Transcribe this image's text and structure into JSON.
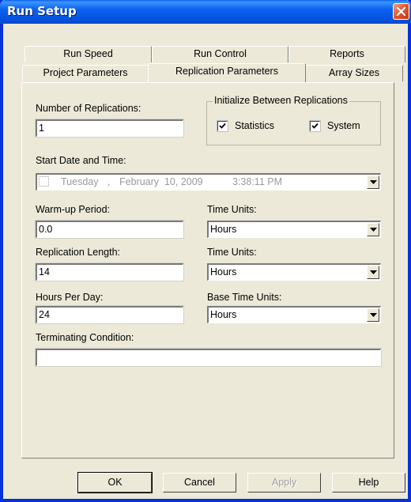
{
  "window": {
    "title": "Run Setup",
    "title_bar_color": "#0b61ee",
    "face_color": "#ece9d8"
  },
  "tabs": {
    "back_row": [
      "Run Speed",
      "Run Control",
      "Reports"
    ],
    "front_row": [
      "Project Parameters",
      "Replication Parameters",
      "Array Sizes"
    ],
    "active": "Replication Parameters"
  },
  "form": {
    "num_replications_label": "Number of Replications:",
    "num_replications_value": "1",
    "init_group_title": "Initialize Between Replications",
    "statistics_label": "Statistics",
    "statistics_checked": true,
    "system_label": "System",
    "system_checked": true,
    "start_date_label": "Start Date and Time:",
    "start_date_day": "Tuesday",
    "start_date_sep": ",",
    "start_date_date": "February  10, 2009",
    "start_date_time": "3:38:11 PM",
    "warmup_label": "Warm-up Period:",
    "warmup_value": "0.0",
    "warmup_units_label": "Time Units:",
    "warmup_units_value": "Hours",
    "rep_length_label": "Replication Length:",
    "rep_length_value": "14",
    "rep_length_units_label": "Time Units:",
    "rep_length_units_value": "Hours",
    "hours_per_day_label": "Hours Per Day:",
    "hours_per_day_value": "24",
    "base_units_label": "Base Time Units:",
    "base_units_value": "Hours",
    "terminating_label": "Terminating Condition:",
    "terminating_value": ""
  },
  "buttons": {
    "ok": "OK",
    "cancel": "Cancel",
    "apply": "Apply",
    "help": "Help"
  }
}
